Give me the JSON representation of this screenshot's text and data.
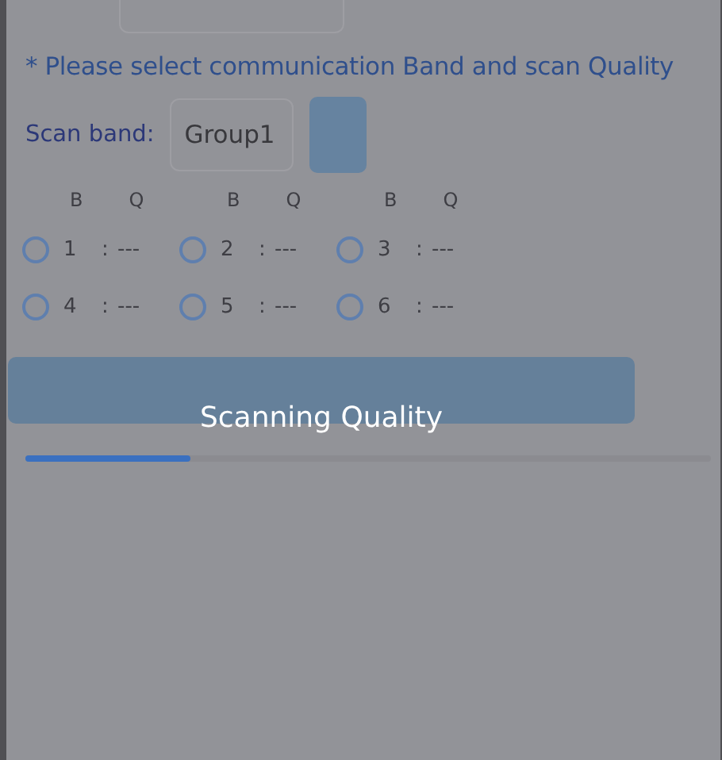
{
  "note": "* Please select communication Band and scan Quality",
  "scan_band": {
    "label": "Scan band:",
    "value": "Group1"
  },
  "column_headers": [
    {
      "band": "B",
      "quality": "Q"
    },
    {
      "band": "B",
      "quality": "Q"
    },
    {
      "band": "B",
      "quality": "Q"
    }
  ],
  "bands": [
    {
      "number": "1",
      "quality": "---",
      "selected": false
    },
    {
      "number": "2",
      "quality": "---",
      "selected": false
    },
    {
      "number": "3",
      "quality": "---",
      "selected": false
    },
    {
      "number": "4",
      "quality": "---",
      "selected": false
    },
    {
      "number": "5",
      "quality": "---",
      "selected": false
    },
    {
      "number": "6",
      "quality": "---",
      "selected": false
    }
  ],
  "separator": ":",
  "overlay": {
    "message": "Scanning Quality",
    "level": 0.24
  }
}
